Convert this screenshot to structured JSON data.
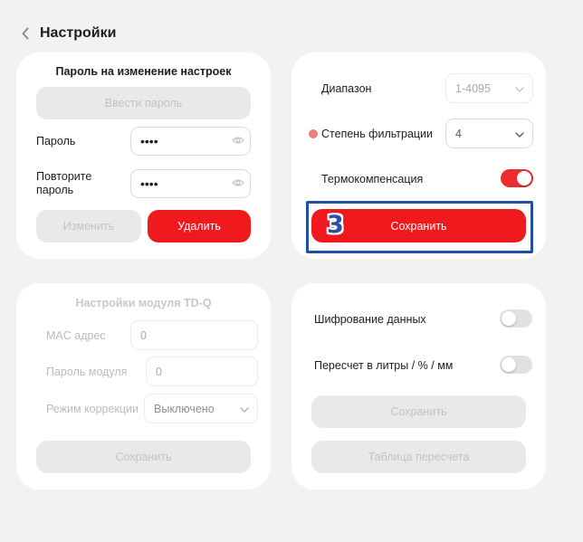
{
  "header": {
    "title": "Настройки",
    "back_icon": "chevron-left-icon"
  },
  "password_card": {
    "title": "Пароль на изменение настроек",
    "enter_password_button": "Ввести пароль",
    "password_label": "Пароль",
    "password_value": "••••",
    "repeat_label_line1": "Повторите",
    "repeat_label_line2": "пароль",
    "repeat_value": "••••",
    "change_button": "Изменить",
    "delete_button": "Удалить"
  },
  "range_card": {
    "range_label": "Диапазон",
    "range_value": "1-4095",
    "filter_label": "Степень фильтрации",
    "filter_value": "4",
    "thermo_label": "Термокомпенсация",
    "thermo_enabled": true,
    "save_button": "Сохранить",
    "step_badge": "3"
  },
  "module_card": {
    "title": "Настройки модуля TD-Q",
    "mac_label": "MAC адрес",
    "mac_value": "0",
    "module_password_label": "Пароль модуля",
    "module_password_value": "0",
    "correction_label": "Режим коррекции",
    "correction_value": "Выключено",
    "save_button": "Сохранить"
  },
  "data_card": {
    "encryption_label": "Шифрование данных",
    "encryption_enabled": false,
    "recalc_label": "Пересчет в литры / % / мм",
    "recalc_enabled": false,
    "save_button": "Сохранить",
    "table_button": "Таблица пересчета"
  },
  "colors": {
    "accent_red": "#f0191e",
    "highlight_blue": "#1f4fa6",
    "background": "#f2f2f3",
    "disabled_grey": "#e9e9eb"
  }
}
